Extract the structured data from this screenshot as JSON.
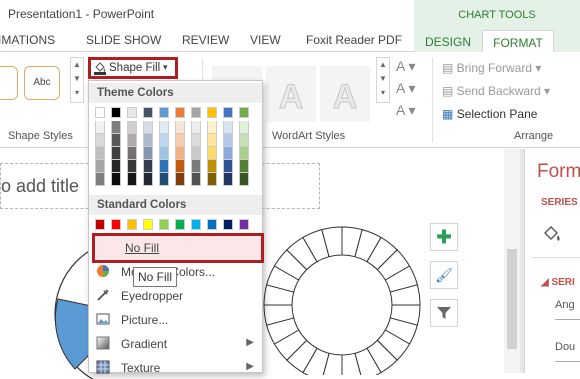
{
  "window": {
    "title": "Presentation1 - PowerPoint"
  },
  "contextual_group": "CHART TOOLS",
  "tabs": {
    "animations": "IMATIONS",
    "slideshow": "SLIDE SHOW",
    "review": "REVIEW",
    "view": "VIEW",
    "foxit": "Foxit Reader PDF",
    "design": "DESIGN",
    "format": "FORMAT"
  },
  "ribbon": {
    "shape_styles_label": "Shape Styles",
    "shape_style_sample": "Abc",
    "shape_fill_label": "Shape Fill",
    "wordart_label": "WordArt Styles",
    "wordart_glyph": "A",
    "arrange_label": "Arrange",
    "bring_forward": "Bring Forward",
    "send_backward": "Send Backward",
    "selection_pane": "Selection Pane"
  },
  "dropdown": {
    "theme_colors_heading": "Theme Colors",
    "standard_colors_heading": "Standard Colors",
    "theme_colors": [
      [
        "#ffffff",
        "#f2f2f2",
        "#d9d9d9",
        "#bfbfbf",
        "#a6a6a6",
        "#7f7f7f"
      ],
      [
        "#000000",
        "#7f7f7f",
        "#595959",
        "#404040",
        "#262626",
        "#0d0d0d"
      ],
      [
        "#e7e6e6",
        "#d0cece",
        "#aeaaaa",
        "#757171",
        "#3a3838",
        "#171616"
      ],
      [
        "#44546a",
        "#d6dce4",
        "#adb9ca",
        "#8497b0",
        "#333f4f",
        "#222a35"
      ],
      [
        "#5b9bd5",
        "#deebf6",
        "#bdd7ee",
        "#9dc3e6",
        "#2e75b5",
        "#1f4e79"
      ],
      [
        "#ed7d31",
        "#fbe5d5",
        "#f7cbac",
        "#f4b183",
        "#c55a11",
        "#833c0b"
      ],
      [
        "#a5a5a5",
        "#ededed",
        "#dbdbdb",
        "#c9c9c9",
        "#7b7b7b",
        "#525252"
      ],
      [
        "#ffc000",
        "#fff2cc",
        "#fee599",
        "#ffd965",
        "#bf9000",
        "#7f6000"
      ],
      [
        "#4472c4",
        "#dae3f3",
        "#b4c7e7",
        "#8faadc",
        "#2f5496",
        "#1f3864"
      ],
      [
        "#70ad47",
        "#e2efd9",
        "#c5e0b3",
        "#a8d08d",
        "#538135",
        "#375623"
      ]
    ],
    "standard_colors": [
      "#c00000",
      "#ff0000",
      "#ffc000",
      "#ffff00",
      "#92d050",
      "#00b050",
      "#00b0f0",
      "#0070c0",
      "#002060",
      "#7030a0"
    ],
    "no_fill": "No Fill",
    "more_fill_colors": "More Fill Colors...",
    "eyedropper": "Eyedropper",
    "picture": "Picture...",
    "gradient": "Gradient",
    "texture": "Texture",
    "tooltip": "No Fill"
  },
  "slide": {
    "title_placeholder": "o add title"
  },
  "format_pane": {
    "title": "Form",
    "series_label": "SERIES",
    "series_sub": "SERI",
    "angle": "Ang",
    "doughnut": "Dou"
  }
}
